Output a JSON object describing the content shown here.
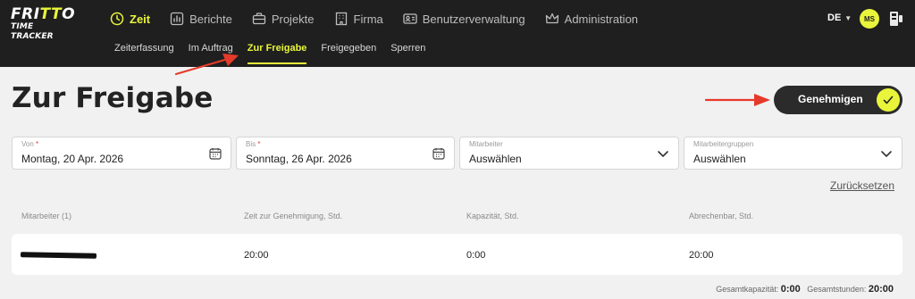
{
  "app": {
    "logo_line1_a": "FRI",
    "logo_line1_b": "TT",
    "logo_line1_c": "O",
    "logo_line2": "TIME TRACKER"
  },
  "nav": {
    "items": [
      {
        "label": "Zeit",
        "icon": "clock-icon",
        "active": true
      },
      {
        "label": "Berichte",
        "icon": "chart-icon"
      },
      {
        "label": "Projekte",
        "icon": "briefcase-icon"
      },
      {
        "label": "Firma",
        "icon": "building-icon"
      },
      {
        "label": "Benutzerverwaltung",
        "icon": "id-card-icon"
      },
      {
        "label": "Administration",
        "icon": "crown-icon"
      }
    ],
    "sub": [
      {
        "label": "Zeiterfassung"
      },
      {
        "label": "Im Auftrag"
      },
      {
        "label": "Zur Freigabe",
        "active": true
      },
      {
        "label": "Freigegeben"
      },
      {
        "label": "Sperren"
      }
    ],
    "language": "DE",
    "avatar_initials": "MS"
  },
  "page": {
    "title": "Zur Freigabe",
    "approve_label": "Genehmigen",
    "reset_label": "Zurücksetzen"
  },
  "filters": {
    "from": {
      "label": "Von",
      "required": "*",
      "value": "Montag, 20 Apr. 2026"
    },
    "to": {
      "label": "Bis",
      "required": "*",
      "value": "Sonntag, 26 Apr. 2026"
    },
    "employee": {
      "label": "Mitarbeiter",
      "value": "Auswählen"
    },
    "groups": {
      "label": "Mitarbeitergruppen",
      "value": "Auswählen"
    }
  },
  "table": {
    "headers": [
      "Mitarbeiter (1)",
      "Zeit zur Genehmigung, Std.",
      "Kapazität, Std.",
      "Abrechenbar, Std."
    ],
    "rows": [
      {
        "employee": "",
        "time": "20:00",
        "capacity": "0:00",
        "billable": "20:00"
      }
    ]
  },
  "totals": {
    "capacity_label": "Gesamtkapazität:",
    "capacity_value": "0:00",
    "hours_label": "Gesamtstunden:",
    "hours_value": "20:00"
  },
  "colors": {
    "accent": "#e9f53b",
    "topbar": "#1f1f1f",
    "annotation_arrow": "#e53a2b"
  }
}
